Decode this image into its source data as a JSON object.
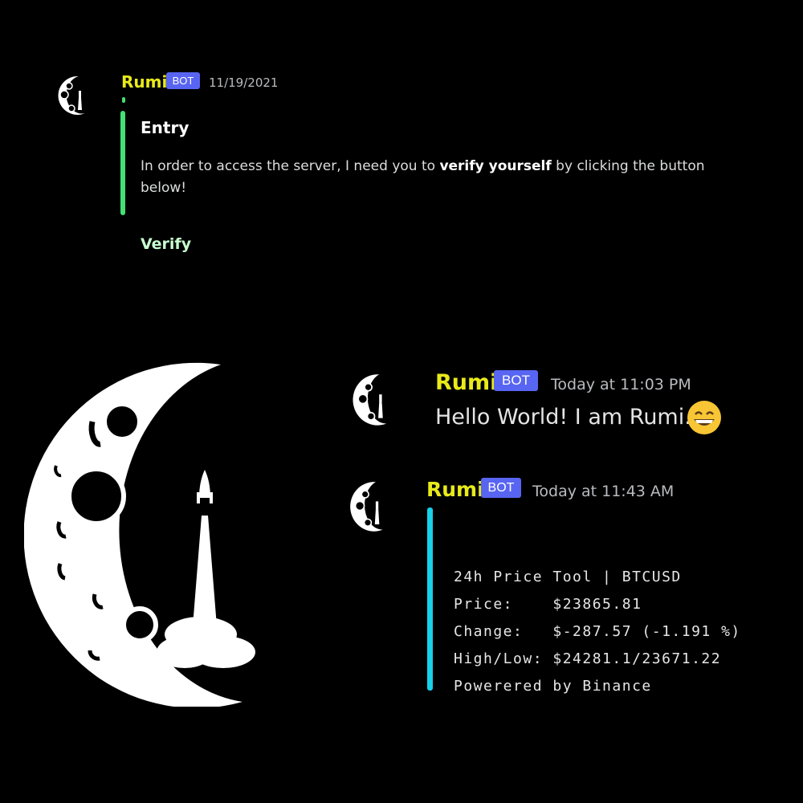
{
  "messages": [
    {
      "author": "Rumi",
      "badge": "BOT",
      "timestamp": "11/19/2021",
      "embed": {
        "title": "Entry",
        "text_before": "In order to access the server, I need you to ",
        "text_bold": "verify yourself",
        "text_after": " by clicking the button below!",
        "accent": "#43e073"
      },
      "button_label": "Verify"
    },
    {
      "author": "Rumi",
      "badge": "BOT",
      "timestamp": "Today at 11:03 PM",
      "content": "Hello World! I am Rumi."
    },
    {
      "author": "Rumi",
      "badge": "BOT",
      "timestamp": "Today at 11:43 AM",
      "embed": {
        "accent": "#17d0ea",
        "lines": [
          "24h Price Tool | BTCUSD",
          "Price:    $23865.81",
          "Change:   $-287.57 (-1.191 %)",
          "High/Low: $24281.1/23671.22",
          "Powerered by Binance"
        ]
      }
    }
  ],
  "colors": {
    "background": "#000000",
    "username": "#e8ea1a",
    "bot_badge": "#5865f2",
    "verify_text": "#c8ffd0"
  },
  "icons": {
    "avatar": "crescent-moon-rocket-icon",
    "emoji": "grinning-face-emoji",
    "logo": "crescent-moon-rocket-logo"
  }
}
